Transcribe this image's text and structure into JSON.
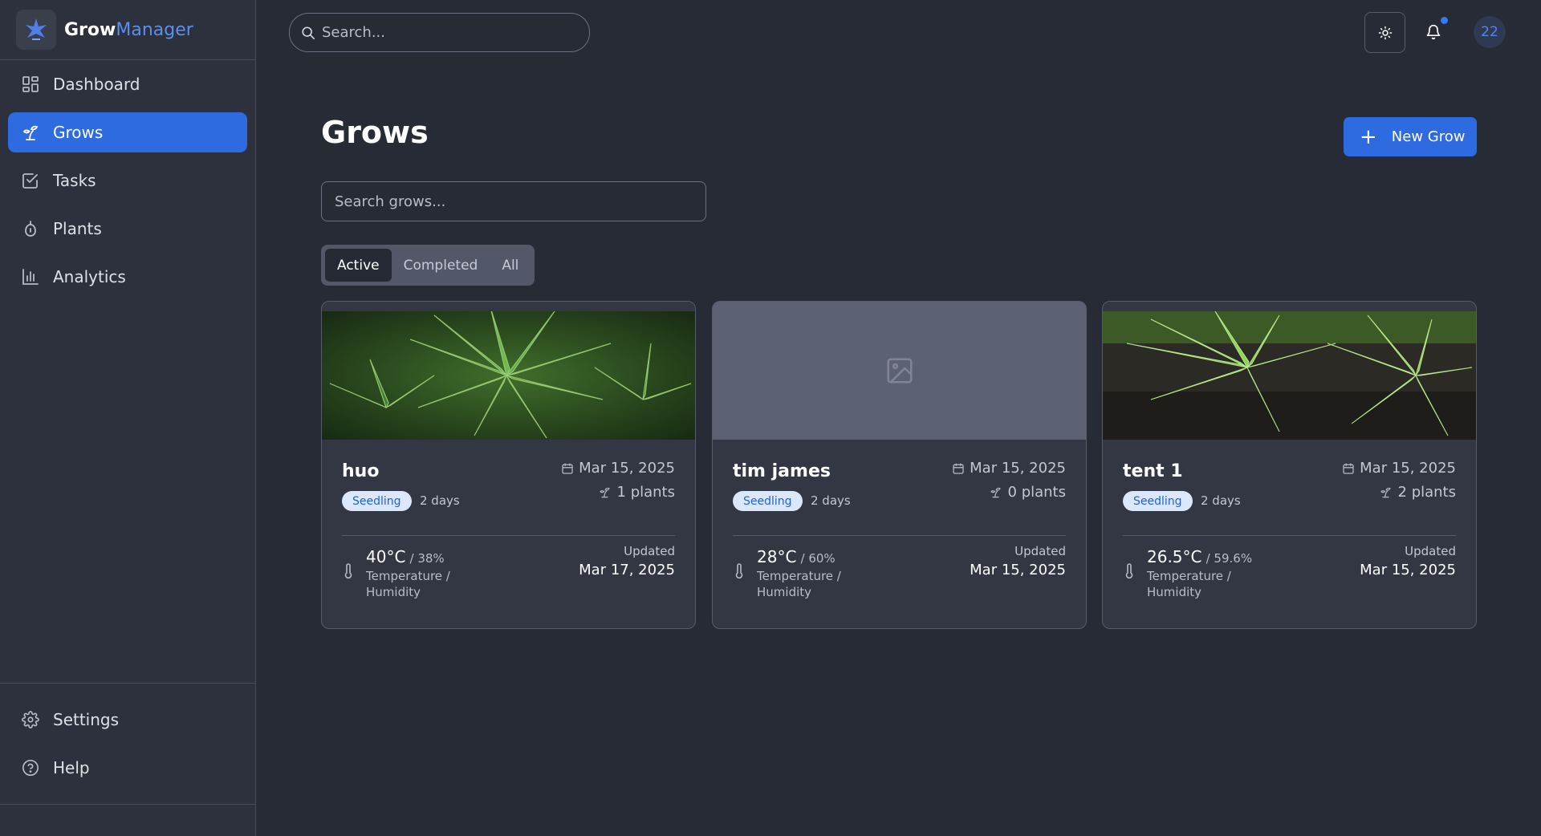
{
  "brand": {
    "part1": "Grow",
    "part2": "Manager",
    "logo_icon": "leaf-star-icon"
  },
  "sidebar": {
    "items": [
      {
        "label": "Dashboard",
        "icon": "dashboard-icon",
        "active": false
      },
      {
        "label": "Grows",
        "icon": "sprout-icon",
        "active": true
      },
      {
        "label": "Tasks",
        "icon": "checkbox-icon",
        "active": false
      },
      {
        "label": "Plants",
        "icon": "seed-icon",
        "active": false
      },
      {
        "label": "Analytics",
        "icon": "bar-chart-icon",
        "active": false
      }
    ],
    "bottom_items": [
      {
        "label": "Settings",
        "icon": "gear-icon"
      },
      {
        "label": "Help",
        "icon": "help-circle-icon"
      }
    ]
  },
  "topbar": {
    "search_placeholder": "Search...",
    "avatar_text": "22",
    "notification_dot_color": "#2f7cf6"
  },
  "page": {
    "title": "Grows",
    "new_button": "New Grow",
    "search_placeholder": "Search grows...",
    "tabs": [
      {
        "label": "Active",
        "active": true
      },
      {
        "label": "Completed",
        "active": false
      },
      {
        "label": "All",
        "active": false
      }
    ]
  },
  "grows": [
    {
      "name": "huo",
      "stage": "Seedling",
      "days": "2 days",
      "date": "Mar 15, 2025",
      "plants": "1 plants",
      "temp": "40°C",
      "humidity": "/ 38%",
      "temp_label": "Temperature / Humidity",
      "updated_label": "Updated",
      "updated": "Mar 17, 2025",
      "has_image": true
    },
    {
      "name": "tim james",
      "stage": "Seedling",
      "days": "2 days",
      "date": "Mar 15, 2025",
      "plants": "0 plants",
      "temp": "28°C",
      "humidity": "/ 60%",
      "temp_label": "Temperature / Humidity",
      "updated_label": "Updated",
      "updated": "Mar 15, 2025",
      "has_image": false
    },
    {
      "name": "tent 1",
      "stage": "Seedling",
      "days": "2 days",
      "date": "Mar 15, 2025",
      "plants": "2 plants",
      "temp": "26.5°C",
      "humidity": "/ 59.6%",
      "temp_label": "Temperature / Humidity",
      "updated_label": "Updated",
      "updated": "Mar 15, 2025",
      "has_image": true
    }
  ],
  "colors": {
    "accent": "#2e6ae0",
    "background": "#272b36",
    "sidebar": "#2d313d",
    "card": "#333743",
    "badge_bg": "#dbe7fb",
    "badge_text": "#2463cf"
  }
}
